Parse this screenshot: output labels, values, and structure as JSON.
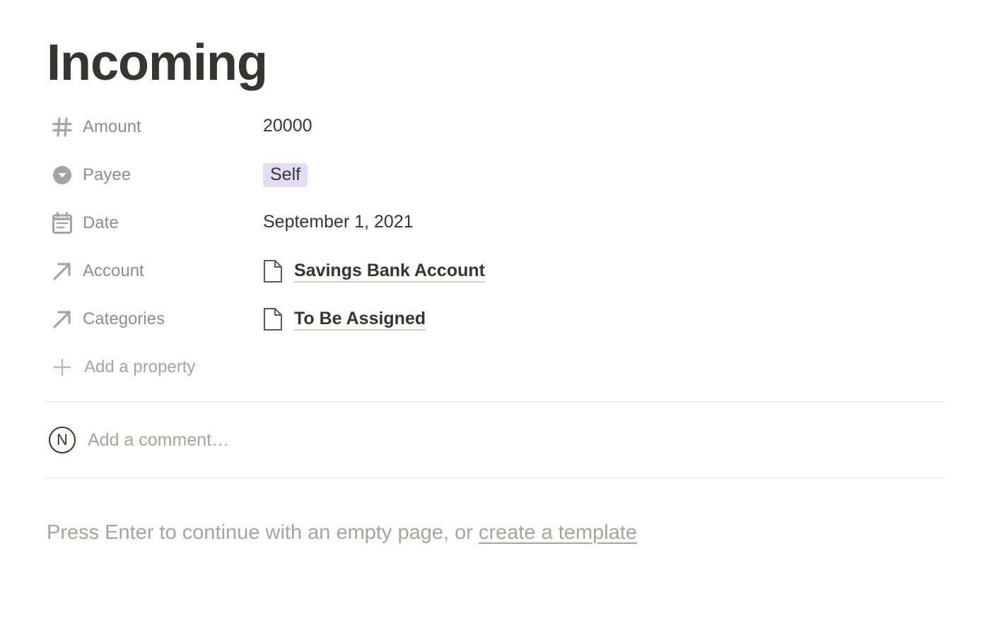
{
  "page": {
    "title": "Incoming"
  },
  "properties": [
    {
      "icon": "hash-icon",
      "name": "Amount",
      "type": "number",
      "value": "20000"
    },
    {
      "icon": "select-icon",
      "name": "Payee",
      "type": "select",
      "value": "Self",
      "tag_color": "#e3dcf5"
    },
    {
      "icon": "calendar-icon",
      "name": "Date",
      "type": "date",
      "value": "September 1, 2021"
    },
    {
      "icon": "relation-arrow-icon",
      "name": "Account",
      "type": "relation",
      "value": "Savings Bank Account",
      "value_icon": "page-icon"
    },
    {
      "icon": "relation-arrow-icon",
      "name": "Categories",
      "type": "relation",
      "value": "To Be Assigned",
      "value_icon": "page-icon"
    }
  ],
  "add_property": {
    "icon": "plus-icon",
    "label": "Add a property"
  },
  "comment": {
    "avatar_letter": "N",
    "placeholder": "Add a comment…"
  },
  "empty_hint": {
    "text": "Press Enter to continue with an empty page, or ",
    "link": "create a template"
  }
}
